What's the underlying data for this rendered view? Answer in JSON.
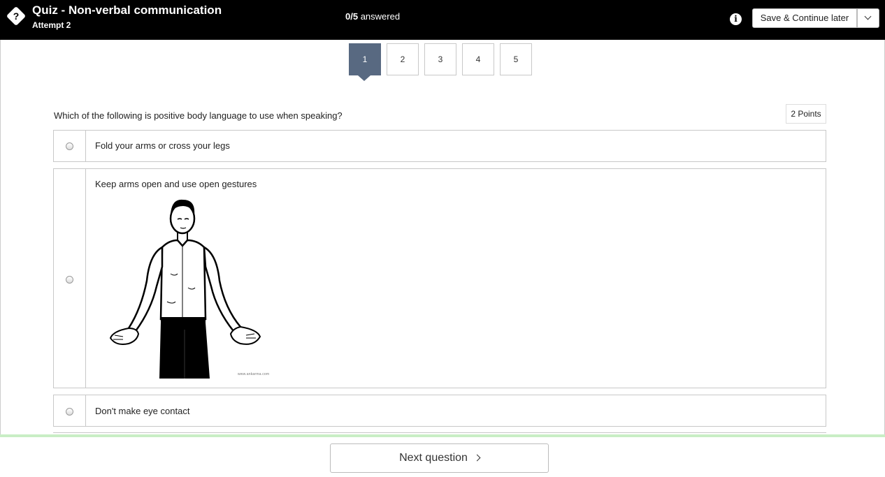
{
  "header": {
    "quiz_icon_glyph": "?",
    "title": "Quiz - Non-verbal communication",
    "attempt": "Attempt 2",
    "answered_count": "0/5",
    "answered_label": "answered",
    "info_icon_glyph": "i",
    "save_label": "Save & Continue later"
  },
  "pagination": {
    "pages": [
      "1",
      "2",
      "3",
      "4",
      "5"
    ],
    "current": "1"
  },
  "question": {
    "text": "Which of the following is positive body language to use when speaking?",
    "points": "2 Points",
    "options": [
      {
        "label": "Fold your arms or cross your legs"
      },
      {
        "label": "Keep arms open and use open gestures",
        "image_watermark": "www.ankarma.com"
      },
      {
        "label": "Don't make eye contact"
      }
    ]
  },
  "footer": {
    "next_label": "Next question"
  },
  "colors": {
    "header_bg": "#000000",
    "active_page": "#586981",
    "footer_accent": "#c9eec5"
  }
}
